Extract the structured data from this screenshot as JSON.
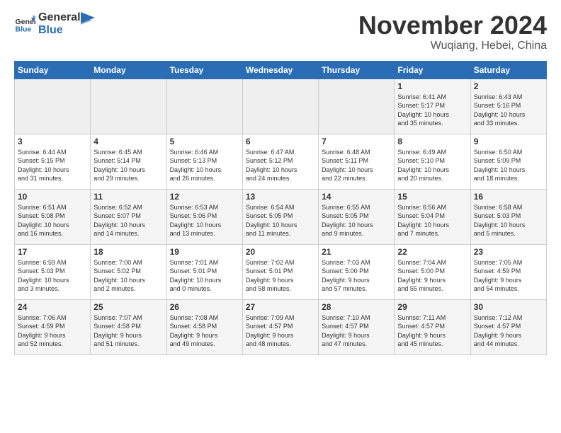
{
  "header": {
    "logo_line1": "General",
    "logo_line2": "Blue",
    "month": "November 2024",
    "location": "Wuqiang, Hebei, China"
  },
  "days_of_week": [
    "Sunday",
    "Monday",
    "Tuesday",
    "Wednesday",
    "Thursday",
    "Friday",
    "Saturday"
  ],
  "weeks": [
    [
      {
        "num": "",
        "info": ""
      },
      {
        "num": "",
        "info": ""
      },
      {
        "num": "",
        "info": ""
      },
      {
        "num": "",
        "info": ""
      },
      {
        "num": "",
        "info": ""
      },
      {
        "num": "1",
        "info": "Sunrise: 6:41 AM\nSunset: 5:17 PM\nDaylight: 10 hours\nand 35 minutes."
      },
      {
        "num": "2",
        "info": "Sunrise: 6:43 AM\nSunset: 5:16 PM\nDaylight: 10 hours\nand 33 minutes."
      }
    ],
    [
      {
        "num": "3",
        "info": "Sunrise: 6:44 AM\nSunset: 5:15 PM\nDaylight: 10 hours\nand 31 minutes."
      },
      {
        "num": "4",
        "info": "Sunrise: 6:45 AM\nSunset: 5:14 PM\nDaylight: 10 hours\nand 29 minutes."
      },
      {
        "num": "5",
        "info": "Sunrise: 6:46 AM\nSunset: 5:13 PM\nDaylight: 10 hours\nand 26 minutes."
      },
      {
        "num": "6",
        "info": "Sunrise: 6:47 AM\nSunset: 5:12 PM\nDaylight: 10 hours\nand 24 minutes."
      },
      {
        "num": "7",
        "info": "Sunrise: 6:48 AM\nSunset: 5:11 PM\nDaylight: 10 hours\nand 22 minutes."
      },
      {
        "num": "8",
        "info": "Sunrise: 6:49 AM\nSunset: 5:10 PM\nDaylight: 10 hours\nand 20 minutes."
      },
      {
        "num": "9",
        "info": "Sunrise: 6:50 AM\nSunset: 5:09 PM\nDaylight: 10 hours\nand 18 minutes."
      }
    ],
    [
      {
        "num": "10",
        "info": "Sunrise: 6:51 AM\nSunset: 5:08 PM\nDaylight: 10 hours\nand 16 minutes."
      },
      {
        "num": "11",
        "info": "Sunrise: 6:52 AM\nSunset: 5:07 PM\nDaylight: 10 hours\nand 14 minutes."
      },
      {
        "num": "12",
        "info": "Sunrise: 6:53 AM\nSunset: 5:06 PM\nDaylight: 10 hours\nand 13 minutes."
      },
      {
        "num": "13",
        "info": "Sunrise: 6:54 AM\nSunset: 5:05 PM\nDaylight: 10 hours\nand 11 minutes."
      },
      {
        "num": "14",
        "info": "Sunrise: 6:55 AM\nSunset: 5:05 PM\nDaylight: 10 hours\nand 9 minutes."
      },
      {
        "num": "15",
        "info": "Sunrise: 6:56 AM\nSunset: 5:04 PM\nDaylight: 10 hours\nand 7 minutes."
      },
      {
        "num": "16",
        "info": "Sunrise: 6:58 AM\nSunset: 5:03 PM\nDaylight: 10 hours\nand 5 minutes."
      }
    ],
    [
      {
        "num": "17",
        "info": "Sunrise: 6:59 AM\nSunset: 5:03 PM\nDaylight: 10 hours\nand 3 minutes."
      },
      {
        "num": "18",
        "info": "Sunrise: 7:00 AM\nSunset: 5:02 PM\nDaylight: 10 hours\nand 2 minutes."
      },
      {
        "num": "19",
        "info": "Sunrise: 7:01 AM\nSunset: 5:01 PM\nDaylight: 10 hours\nand 0 minutes."
      },
      {
        "num": "20",
        "info": "Sunrise: 7:02 AM\nSunset: 5:01 PM\nDaylight: 9 hours\nand 58 minutes."
      },
      {
        "num": "21",
        "info": "Sunrise: 7:03 AM\nSunset: 5:00 PM\nDaylight: 9 hours\nand 57 minutes."
      },
      {
        "num": "22",
        "info": "Sunrise: 7:04 AM\nSunset: 5:00 PM\nDaylight: 9 hours\nand 55 minutes."
      },
      {
        "num": "23",
        "info": "Sunrise: 7:05 AM\nSunset: 4:59 PM\nDaylight: 9 hours\nand 54 minutes."
      }
    ],
    [
      {
        "num": "24",
        "info": "Sunrise: 7:06 AM\nSunset: 4:59 PM\nDaylight: 9 hours\nand 52 minutes."
      },
      {
        "num": "25",
        "info": "Sunrise: 7:07 AM\nSunset: 4:58 PM\nDaylight: 9 hours\nand 51 minutes."
      },
      {
        "num": "26",
        "info": "Sunrise: 7:08 AM\nSunset: 4:58 PM\nDaylight: 9 hours\nand 49 minutes."
      },
      {
        "num": "27",
        "info": "Sunrise: 7:09 AM\nSunset: 4:57 PM\nDaylight: 9 hours\nand 48 minutes."
      },
      {
        "num": "28",
        "info": "Sunrise: 7:10 AM\nSunset: 4:57 PM\nDaylight: 9 hours\nand 47 minutes."
      },
      {
        "num": "29",
        "info": "Sunrise: 7:11 AM\nSunset: 4:57 PM\nDaylight: 9 hours\nand 45 minutes."
      },
      {
        "num": "30",
        "info": "Sunrise: 7:12 AM\nSunset: 4:57 PM\nDaylight: 9 hours\nand 44 minutes."
      }
    ]
  ]
}
